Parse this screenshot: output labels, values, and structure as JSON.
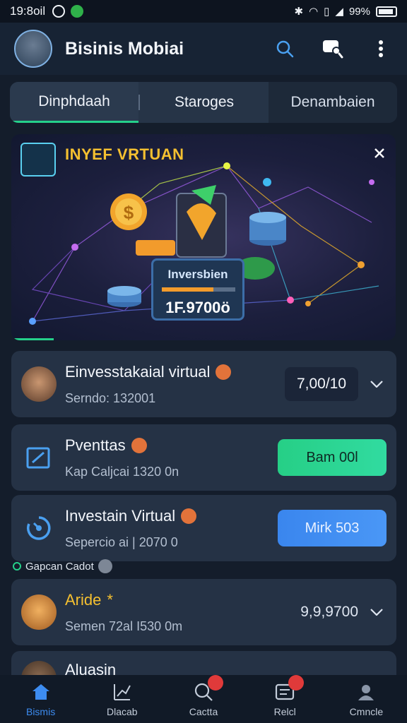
{
  "status_bar": {
    "time": "19:8oil",
    "battery": "99%"
  },
  "app_bar": {
    "title": "Bisinis Mobiai"
  },
  "tabs": [
    {
      "label": "Dinphdaah"
    },
    {
      "label": "Staroges"
    },
    {
      "label": "Denambaien"
    }
  ],
  "banner": {
    "title": "INYEF VRTUAN",
    "panel_label": "Inversbien",
    "panel_value": "1F.9700ö",
    "progress": 0.7
  },
  "cards": [
    {
      "title": "Einvesstakaial virtual",
      "subtitle": "Serndo: 132001",
      "value": "7,00/10"
    },
    {
      "title": "Pventtas",
      "subtitle": "Kap Caljcai 1320 0n",
      "button": "Bam 00l"
    },
    {
      "title": "Investain Virtual",
      "subtitle": "Sepercio ai | 2070 0",
      "button": "Mirk 503"
    }
  ],
  "section_label": "Gapcan Cadot",
  "card4": {
    "title": "Aride",
    "title_mark": "*",
    "subtitle": "Semen 72al I530 0m",
    "value": "9,9,9700"
  },
  "card5": {
    "title": "Aluasin"
  },
  "bottom_nav": [
    {
      "label": "Bismis",
      "icon": "home-icon"
    },
    {
      "label": "Dlacab",
      "icon": "chart-icon"
    },
    {
      "label": "Cactta",
      "icon": "search-icon"
    },
    {
      "label": "Relcl",
      "icon": "report-icon"
    },
    {
      "label": "Cmncle",
      "icon": "profile-icon"
    }
  ],
  "colors": {
    "accent_green": "#25d08a",
    "accent_blue": "#3d8cf0",
    "banner_gold": "#f5c030",
    "badge_orange": "#e2733a",
    "notification_red": "#e03a3a"
  }
}
